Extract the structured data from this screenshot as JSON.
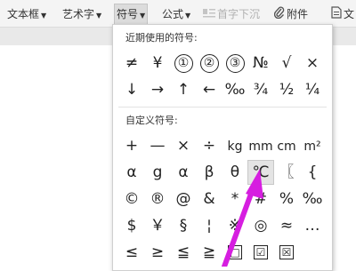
{
  "toolbar": {
    "textbox": "文本框",
    "arttext": "艺术字",
    "symbol": "符号",
    "formula": "公式",
    "dropcap": "首字下沉",
    "attachment": "附件",
    "more": "文"
  },
  "menu": {
    "recent_title": "近期使用的符号:",
    "recent": [
      [
        "≠",
        "¥",
        "①",
        "②",
        "③",
        "№",
        "√",
        "×"
      ],
      [
        "↓",
        "→",
        "↑",
        "←",
        "‰",
        "¾",
        "½",
        "¼"
      ]
    ],
    "custom_title": "自定义符号:",
    "custom": [
      [
        "+",
        "—",
        "×",
        "÷",
        "kg",
        "mm",
        "cm",
        "m²"
      ],
      [
        "α",
        "g",
        "α",
        "β",
        "θ",
        "℃",
        "〖",
        "{"
      ],
      [
        "©",
        "®",
        "@",
        "&",
        "*",
        "#",
        "%",
        "‰"
      ],
      [
        "$",
        "￥",
        "§",
        "¦",
        "※",
        "◎",
        "≈",
        "…"
      ],
      [
        "≤",
        "≥",
        "≦",
        "≧",
        "□",
        "☑",
        "☒",
        ""
      ]
    ]
  },
  "colors": {
    "arrow": "#d61ee0",
    "highlight": "#e4e4e4"
  },
  "icons": {
    "dropcap": "dropcap-icon",
    "attachment": "paperclip-icon",
    "more": "document-icon"
  }
}
